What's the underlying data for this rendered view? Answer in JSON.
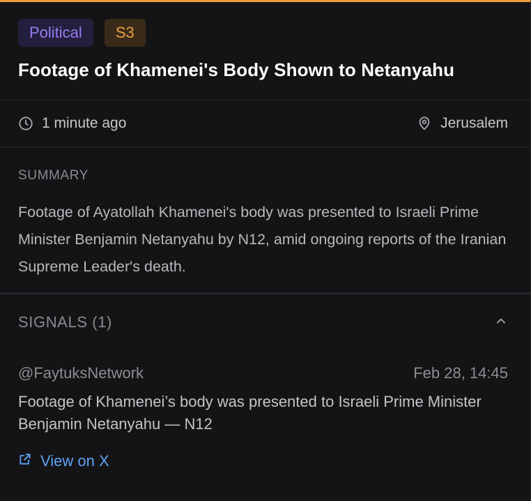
{
  "badges": {
    "category": "Political",
    "severity": "S3"
  },
  "title": "Footage of Khamenei's Body Shown to Netanyahu",
  "meta": {
    "time": "1 minute ago",
    "location": "Jerusalem"
  },
  "summary": {
    "label": "SUMMARY",
    "text": "Footage of Ayatollah Khamenei's body was presented to Israeli Prime Minister Benjamin Netanyahu by N12, amid ongoing reports of the Iranian Supreme Leader's death."
  },
  "signals": {
    "label": "SIGNALS (1)",
    "items": [
      {
        "source": "@FaytuksNetwork",
        "timestamp": "Feb 28, 14:45",
        "text": "Footage of Khamenei’s body was presented to Israeli Prime Minister Benjamin Netanyahu — N12",
        "link_label": "View on X"
      }
    ]
  },
  "colors": {
    "accent_top_border": "#e59a3c",
    "political_badge_text": "#9b7cf0",
    "severity_badge_text": "#e9a245",
    "link": "#5ea2f4"
  },
  "icons": {
    "time": "clock-icon",
    "location": "map-pin-icon",
    "collapse": "chevron-up-icon",
    "external": "external-link-icon"
  }
}
